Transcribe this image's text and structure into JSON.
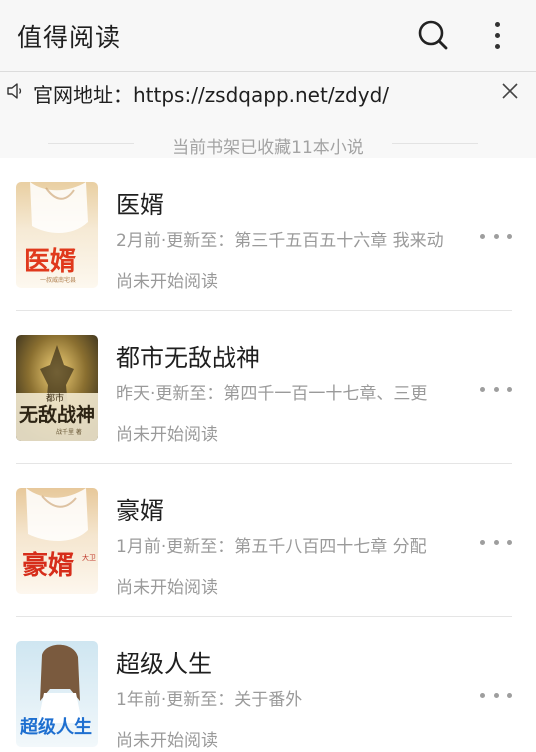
{
  "appbar": {
    "title": "值得阅读",
    "icons": [
      "search-icon",
      "more-vert-icon"
    ]
  },
  "notice": {
    "text": "官网地址：https://zsdqapp.net/zdyd/",
    "icons": [
      "speaker-icon",
      "close-icon"
    ]
  },
  "shelf": {
    "count_text": "当前书架已收藏11本小说"
  },
  "books": [
    {
      "title": "医婿",
      "update": "2月前·更新至：第三千五百五十六章 我来动",
      "status": "尚未开始阅读",
      "cover": {
        "text": "医婿",
        "subtitle": "一叔威南宅县",
        "colors": {
          "top": "#f2e1c2",
          "bottom": "#fbf4e7",
          "text": "#e0391c"
        }
      }
    },
    {
      "title": "都市无敌战神",
      "update": "昨天·更新至：第四千一百一十七章、三更",
      "status": "尚未开始阅读",
      "cover": {
        "text": "无敌战神",
        "top_text": "都市",
        "subtitle": "战千里 著",
        "colors": {
          "top": "#2c2a1e",
          "bottom": "#b09a5a",
          "text": "#f2d487"
        }
      }
    },
    {
      "title": "豪婿",
      "update": "1月前·更新至：第五千八百四十七章 分配",
      "status": "尚未开始阅读",
      "cover": {
        "text": "豪婿",
        "subtitle": "大卫",
        "colors": {
          "top": "#f1dcc0",
          "bottom": "#fbf3e6",
          "text": "#d62d1a"
        }
      }
    },
    {
      "title": "超级人生",
      "update": "1年前·更新至：关于番外",
      "status": "尚未开始阅读",
      "cover": {
        "text": "超级人生",
        "colors": {
          "top": "#d8ecf4",
          "bottom": "#eef6fa",
          "text": "#1e6fd0"
        }
      }
    }
  ]
}
